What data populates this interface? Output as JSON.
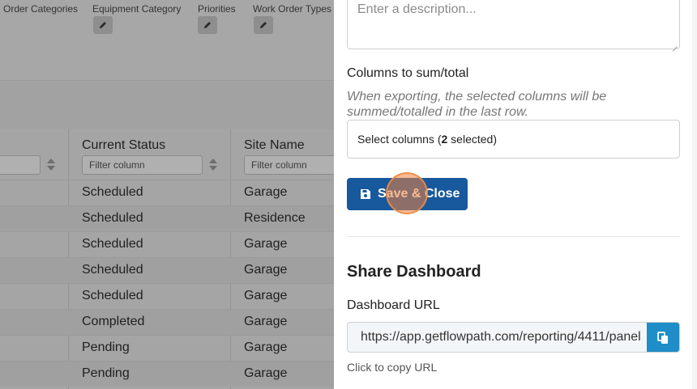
{
  "background": {
    "categories": [
      {
        "label": "Order Categories"
      },
      {
        "label": "Equipment Category"
      },
      {
        "label": "Priorities"
      },
      {
        "label": "Work Order Types"
      }
    ],
    "table": {
      "columns": [
        {
          "header": "Current Status",
          "filter_placeholder": "Filter column"
        },
        {
          "header": "Site Name",
          "filter_placeholder": "Filter column"
        }
      ],
      "first_filter_placeholder": "",
      "rows": [
        {
          "status": "Scheduled",
          "site": "Garage"
        },
        {
          "status": "Scheduled",
          "site": "Residence"
        },
        {
          "status": "Scheduled",
          "site": "Garage"
        },
        {
          "status": "Scheduled",
          "site": "Garage"
        },
        {
          "status": "Scheduled",
          "site": "Garage"
        },
        {
          "status": "Completed",
          "site": "Garage"
        },
        {
          "status": "Pending",
          "site": "Garage"
        },
        {
          "status": "Pending",
          "site": "Garage"
        }
      ]
    }
  },
  "panel": {
    "description_placeholder": "Enter a description...",
    "columns_label": "Columns to sum/total",
    "columns_help": "When exporting, the selected columns will be summed/totalled in the last row.",
    "select_prefix": "Select columns (",
    "select_count": "2",
    "select_suffix": " selected)",
    "save_label": "Save & Close",
    "share_heading": "Share Dashboard",
    "url_label": "Dashboard URL",
    "url_value": "https://app.getflowpath.com/reporting/4411/panel",
    "copy_hint": "Click to copy URL"
  },
  "colors": {
    "primary": "#18589d",
    "copy_button": "#1e8dc8",
    "overlay": "#a3a3a3"
  },
  "icons": {
    "edit": "pencil-icon",
    "save": "floppy-disk-icon",
    "copy": "copy-icon",
    "sort": "sort-icon"
  }
}
